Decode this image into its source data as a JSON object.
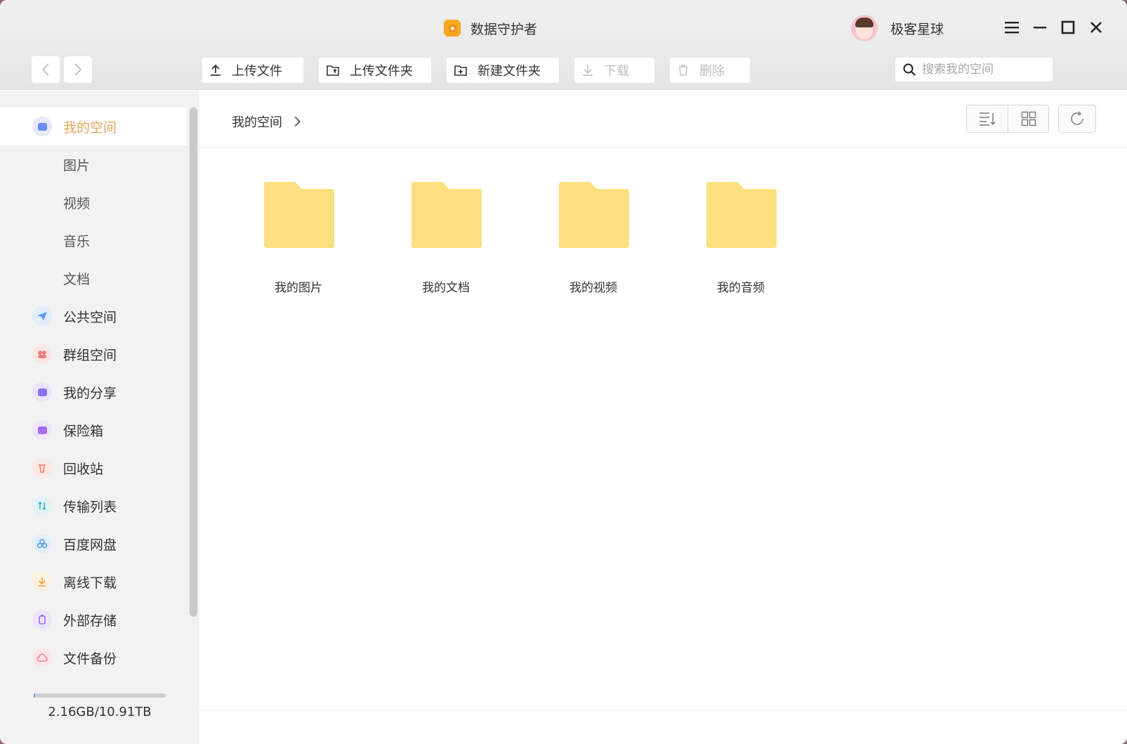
{
  "window": {
    "title": "数据守护者",
    "user_name": "极客星球"
  },
  "toolbar": {
    "upload_file": "上传文件",
    "upload_folder": "上传文件夹",
    "new_folder": "新建文件夹",
    "download": "下载",
    "delete": "删除",
    "search_placeholder": "搜索我的空间"
  },
  "sidebar": {
    "items": [
      {
        "label": "我的空间",
        "icon": "my-space-icon",
        "color": "#6c8cf5"
      },
      {
        "label": "图片"
      },
      {
        "label": "视频"
      },
      {
        "label": "音乐"
      },
      {
        "label": "文档"
      },
      {
        "label": "公共空间",
        "icon": "paper-plane-icon",
        "color": "#5b9cf5"
      },
      {
        "label": "群组空间",
        "icon": "group-icon",
        "color": "#f07c7c"
      },
      {
        "label": "我的分享",
        "icon": "share-icon",
        "color": "#8f6cf5"
      },
      {
        "label": "保险箱",
        "icon": "safe-icon",
        "color": "#a86cf0"
      },
      {
        "label": "回收站",
        "icon": "trash-icon",
        "color": "#f07c6c"
      },
      {
        "label": "传输列表",
        "icon": "transfer-icon",
        "color": "#3fb4c9"
      },
      {
        "label": "百度网盘",
        "icon": "cloud-drive-icon",
        "color": "#4a9bf0"
      },
      {
        "label": "离线下载",
        "icon": "download-icon",
        "color": "#f2a13b"
      },
      {
        "label": "外部存储",
        "icon": "external-storage-icon",
        "color": "#9a6cf0"
      },
      {
        "label": "文件备份",
        "icon": "backup-icon",
        "color": "#f07c8c"
      }
    ],
    "quota": "2.16GB/10.91TB",
    "quota_fraction": 0.0002
  },
  "main": {
    "breadcrumb": "我的空间",
    "folders": [
      {
        "name": "我的图片"
      },
      {
        "name": "我的文档"
      },
      {
        "name": "我的视频"
      },
      {
        "name": "我的音频"
      }
    ],
    "folder_color": "#fcdf7e"
  }
}
